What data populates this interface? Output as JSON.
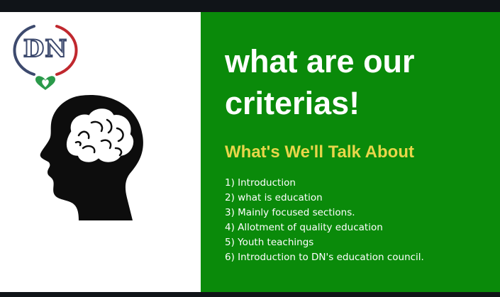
{
  "slide": {
    "logo_text": "DN",
    "title_line1": "what are our",
    "title_line2": "criterias!",
    "subtitle": "What's We'll Talk About",
    "agenda": [
      "1) Introduction",
      "2) what is education",
      "3) Mainly focused sections.",
      "4) Allotment of quality education",
      "5) Youth teachings",
      "6) Introduction to DN's education council."
    ]
  },
  "colors": {
    "green_panel": "#0a8a0a",
    "subtitle_yellow": "#e8d64a",
    "logo_red": "#c0282e",
    "logo_navy": "#3d4a6e",
    "logo_leaf_green": "#2a9a4a"
  },
  "icons": [
    "dn-logo-icon",
    "heart-leaf-icon",
    "head-brain-icon"
  ]
}
